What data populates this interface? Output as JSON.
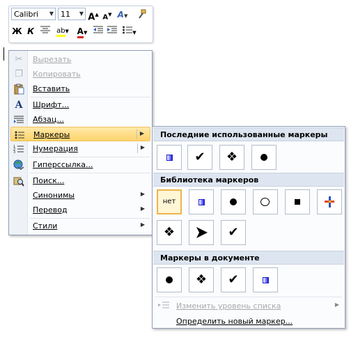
{
  "mini_toolbar": {
    "font_name": "Calibri",
    "font_size": "11",
    "grow_font": "A",
    "shrink_font": "A",
    "bold": "Ж",
    "italic": "К",
    "highlight": "ab",
    "font_color": "A"
  },
  "context_menu": {
    "items": [
      {
        "label": "Вырезать",
        "icon": "scissors-icon",
        "enabled": false
      },
      {
        "label": "Копировать",
        "icon": "copy-icon",
        "enabled": false
      },
      {
        "label": "Вставить",
        "icon": "paste-icon",
        "enabled": true
      },
      {
        "label": "Шрифт...",
        "icon": "font-icon",
        "enabled": true
      },
      {
        "label": "Абзац...",
        "icon": "paragraph-icon",
        "enabled": true
      },
      {
        "label": "Маркеры",
        "icon": "bullets-icon",
        "enabled": true,
        "highlighted": true,
        "submenu": true
      },
      {
        "label": "Нумерация",
        "icon": "numbering-icon",
        "enabled": true,
        "submenu": true
      },
      {
        "label": "Гиперссылка...",
        "icon": "hyperlink-icon",
        "enabled": true
      },
      {
        "label": "Поиск...",
        "icon": "search-icon",
        "enabled": true
      },
      {
        "label": "Синонимы",
        "enabled": true,
        "submenu": true
      },
      {
        "label": "Перевод",
        "enabled": true,
        "submenu": true
      },
      {
        "label": "Стили",
        "enabled": true,
        "submenu": true
      }
    ]
  },
  "bullets_submenu": {
    "recent_header": "Последние использованные маркеры",
    "library_header": "Библиотека маркеров",
    "document_header": "Маркеры в документе",
    "none_label": "нет",
    "change_level": "Изменить уровень списка",
    "define_new": "Определить новый маркер..."
  },
  "colors": {
    "highlight": "#ffd36b",
    "section_header": "#dde5f0",
    "blue_bullet": "#1d1df0"
  }
}
